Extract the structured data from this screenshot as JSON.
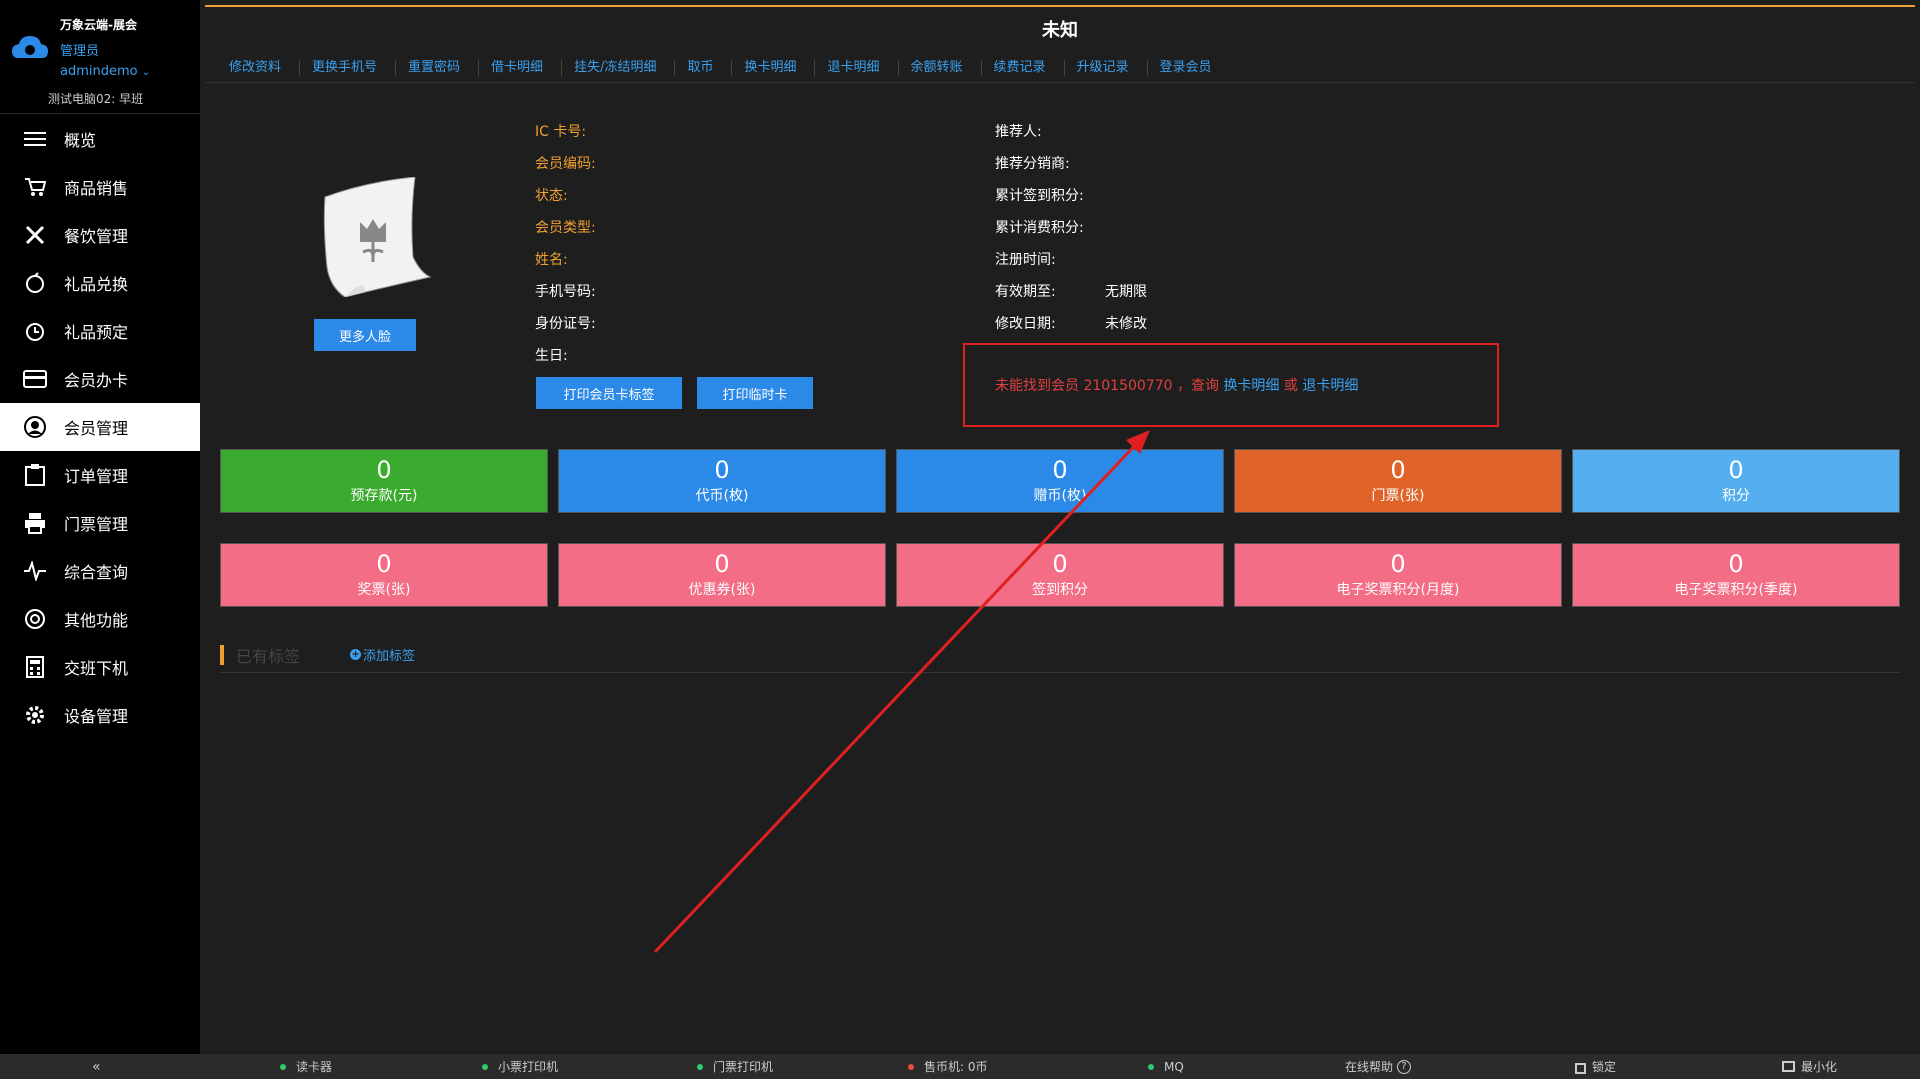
{
  "brand": {
    "app_name": "万象云端-展会",
    "role": "管理员",
    "user": "admindemo",
    "pc": "测试电脑02: 早班"
  },
  "nav": [
    {
      "label": "概览",
      "icon": "menu-icon"
    },
    {
      "label": "商品销售",
      "icon": "cart-icon"
    },
    {
      "label": "餐饮管理",
      "icon": "utensils-icon"
    },
    {
      "label": "礼品兑换",
      "icon": "gift-icon"
    },
    {
      "label": "礼品预定",
      "icon": "alarm-clock-icon"
    },
    {
      "label": "会员办卡",
      "icon": "card-icon"
    },
    {
      "label": "会员管理",
      "icon": "user-icon",
      "active": true
    },
    {
      "label": "订单管理",
      "icon": "clipboard-icon"
    },
    {
      "label": "门票管理",
      "icon": "printer-icon"
    },
    {
      "label": "综合查询",
      "icon": "pulse-icon"
    },
    {
      "label": "其他功能",
      "icon": "aperture-icon"
    },
    {
      "label": "交班下机",
      "icon": "calculator-icon"
    },
    {
      "label": "设备管理",
      "icon": "gear-icon"
    }
  ],
  "page_title": "未知",
  "tabs": [
    "修改资料",
    "更换手机号",
    "重置密码",
    "借卡明细",
    "挂失/冻结明细",
    "取币",
    "换卡明细",
    "退卡明细",
    "余额转账",
    "续费记录",
    "升级记录",
    "登录会员"
  ],
  "more_face_label": "更多人脸",
  "left_fields": [
    {
      "label": "IC 卡号:",
      "color": "orange"
    },
    {
      "label": "会员编码:",
      "color": "orange"
    },
    {
      "label": "状态:",
      "color": "orange"
    },
    {
      "label": "会员类型:",
      "color": "orange"
    },
    {
      "label": "姓名:",
      "color": "orange"
    },
    {
      "label": "手机号码:",
      "color": "white"
    },
    {
      "label": "身份证号:",
      "color": "white"
    },
    {
      "label": "生日:",
      "color": "white"
    }
  ],
  "right_fields": [
    {
      "label": "推荐人:",
      "value": ""
    },
    {
      "label": "推荐分销商:",
      "value": ""
    },
    {
      "label": "累计签到积分:",
      "value": ""
    },
    {
      "label": "累计消费积分:",
      "value": ""
    },
    {
      "label": "注册时间:",
      "value": ""
    },
    {
      "label": "有效期至:",
      "value": "无期限"
    },
    {
      "label": "修改日期:",
      "value": "未修改"
    }
  ],
  "print_card_label": "打印会员卡标签",
  "print_temp_label": "打印临时卡",
  "alert": {
    "prefix": "未能找到会员 2101500770 ，查询",
    "link1": "换卡明细",
    "mid": "或",
    "link2": "退卡明细"
  },
  "cards_row1": [
    {
      "value": "0",
      "label": "预存款(元)",
      "color": "#3aab2e"
    },
    {
      "value": "0",
      "label": "代币(枚)",
      "color": "#2b8ae8"
    },
    {
      "value": "0",
      "label": "赠币(枚)",
      "color": "#2b8ae8"
    },
    {
      "value": "0",
      "label": "门票(张)",
      "color": "#e0642a"
    },
    {
      "value": "0",
      "label": "积分",
      "color": "#55aef0"
    }
  ],
  "cards_row2": [
    {
      "value": "0",
      "label": "奖票(张)",
      "color": "#f26d85"
    },
    {
      "value": "0",
      "label": "优惠券(张)",
      "color": "#f26d85"
    },
    {
      "value": "0",
      "label": "签到积分",
      "color": "#f26d85"
    },
    {
      "value": "0",
      "label": "电子奖票积分(月度)",
      "color": "#f26d85"
    },
    {
      "value": "0",
      "label": "电子奖票积分(季度)",
      "color": "#f26d85"
    }
  ],
  "tags": {
    "title": "已有标签",
    "add_label": "添加标签"
  },
  "status_bar": {
    "collapse": "«",
    "reader": "读卡器",
    "receipt_printer": "小票打印机",
    "ticket_printer": "门票打印机",
    "coin_machine": "售币机: 0币",
    "mq": "MQ",
    "help": "在线帮助",
    "lock": "锁定",
    "minimize": "最小化"
  },
  "colors": {
    "accent": "#2b8ae8",
    "link": "#3aa0f0",
    "label_orange": "#f0a030",
    "alert_red": "#e02020",
    "status_green": "#2ecc71",
    "status_red": "#e74c3c"
  }
}
